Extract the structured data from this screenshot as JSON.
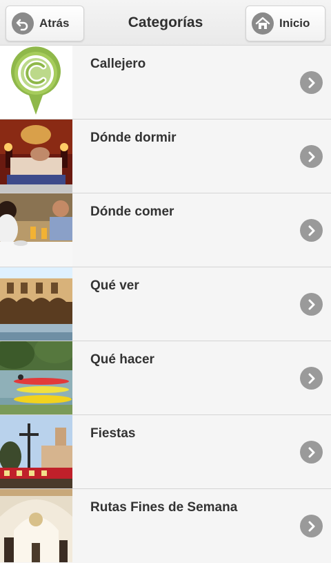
{
  "header": {
    "title": "Categorías",
    "back_label": "Atrás",
    "home_label": "Inicio",
    "back_icon": "back-arrow-icon",
    "home_icon": "home-icon"
  },
  "categories": [
    {
      "label": "Callejero",
      "thumb": "map-pin-logo"
    },
    {
      "label": "Dónde dormir",
      "thumb": "hotel-photo"
    },
    {
      "label": "Dónde comer",
      "thumb": "restaurant-photo"
    },
    {
      "label": "Qué ver",
      "thumb": "courtyard-photo"
    },
    {
      "label": "Qué hacer",
      "thumb": "kayaks-photo"
    },
    {
      "label": "Fiestas",
      "thumb": "procession-photo"
    },
    {
      "label": "Rutas Fines de Semana",
      "thumb": "church-interior-photo"
    }
  ],
  "colors": {
    "header_bg": "#eeeeee",
    "row_bg": "#f5f5f5",
    "chevron_bg": "#9a9a9a",
    "logo_green": "#8fb84a"
  }
}
